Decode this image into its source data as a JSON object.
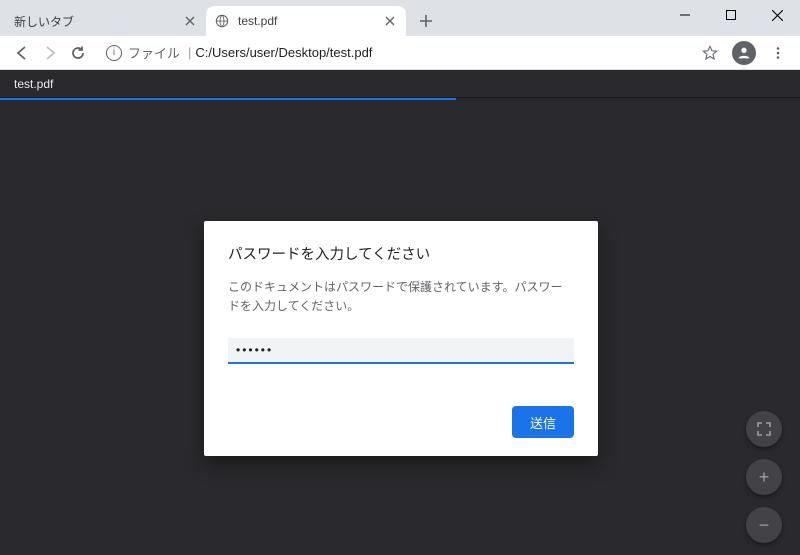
{
  "tabs": {
    "inactive": {
      "title": "新しいタブ"
    },
    "active": {
      "title": "test.pdf"
    }
  },
  "omnibox": {
    "prefix": "ファイル",
    "url": "C:/Users/user/Desktop/test.pdf"
  },
  "viewer": {
    "filename": "test.pdf"
  },
  "dialog": {
    "title": "パスワードを入力してください",
    "message": "このドキュメントはパスワードで保護されています。パスワードを入力してください。",
    "password_value": "••••••",
    "submit_label": "送信"
  },
  "zoom": {
    "fit": "⛶",
    "in": "+",
    "out": "−"
  }
}
